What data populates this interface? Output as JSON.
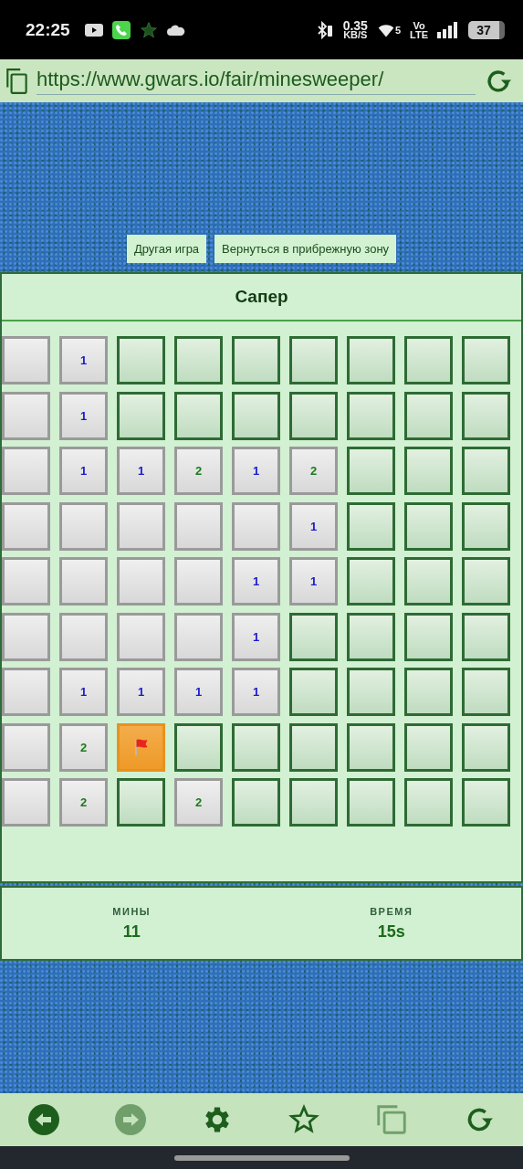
{
  "status_bar": {
    "time": "22:25",
    "speed": "0.35",
    "speed_unit": "KB/S",
    "wifi_band": "5",
    "volte_top": "Vo",
    "volte_bottom": "LTE",
    "battery": "37"
  },
  "address_bar": {
    "url": "https://www.gwars.io/fair/minesweeper/"
  },
  "top_buttons": [
    "Другая игра",
    "Вернуться в прибрежную зону"
  ],
  "game": {
    "title": "Сапер",
    "rows": [
      [
        {
          "kind": "open"
        },
        {
          "kind": "open",
          "text": "1",
          "color": "#1a1acc"
        },
        {
          "kind": "hidden"
        },
        {
          "kind": "hidden"
        },
        {
          "kind": "hidden"
        },
        {
          "kind": "hidden"
        },
        {
          "kind": "hidden"
        },
        {
          "kind": "hidden"
        },
        {
          "kind": "hidden"
        }
      ],
      [
        {
          "kind": "open"
        },
        {
          "kind": "open",
          "text": "1",
          "color": "#1a1acc"
        },
        {
          "kind": "hidden"
        },
        {
          "kind": "hidden"
        },
        {
          "kind": "hidden"
        },
        {
          "kind": "hidden"
        },
        {
          "kind": "hidden"
        },
        {
          "kind": "hidden"
        },
        {
          "kind": "hidden"
        }
      ],
      [
        {
          "kind": "open"
        },
        {
          "kind": "open",
          "text": "1",
          "color": "#1a1acc"
        },
        {
          "kind": "open",
          "text": "1",
          "color": "#1a1acc"
        },
        {
          "kind": "open",
          "text": "2",
          "color": "#1b7a1b"
        },
        {
          "kind": "open",
          "text": "1",
          "color": "#1a1acc"
        },
        {
          "kind": "open",
          "text": "2",
          "color": "#1b7a1b"
        },
        {
          "kind": "hidden"
        },
        {
          "kind": "hidden"
        },
        {
          "kind": "hidden"
        }
      ],
      [
        {
          "kind": "open"
        },
        {
          "kind": "open"
        },
        {
          "kind": "open"
        },
        {
          "kind": "open"
        },
        {
          "kind": "open"
        },
        {
          "kind": "open",
          "text": "1",
          "color": "#1a1acc"
        },
        {
          "kind": "hidden"
        },
        {
          "kind": "hidden"
        },
        {
          "kind": "hidden"
        }
      ],
      [
        {
          "kind": "open"
        },
        {
          "kind": "open"
        },
        {
          "kind": "open"
        },
        {
          "kind": "open"
        },
        {
          "kind": "open",
          "text": "1",
          "color": "#1a1acc"
        },
        {
          "kind": "open",
          "text": "1",
          "color": "#1a1acc"
        },
        {
          "kind": "hidden"
        },
        {
          "kind": "hidden"
        },
        {
          "kind": "hidden"
        }
      ],
      [
        {
          "kind": "open"
        },
        {
          "kind": "open"
        },
        {
          "kind": "open"
        },
        {
          "kind": "open"
        },
        {
          "kind": "open",
          "text": "1",
          "color": "#1a1acc"
        },
        {
          "kind": "hidden"
        },
        {
          "kind": "hidden"
        },
        {
          "kind": "hidden"
        },
        {
          "kind": "hidden"
        }
      ],
      [
        {
          "kind": "open"
        },
        {
          "kind": "open",
          "text": "1",
          "color": "#1a1acc"
        },
        {
          "kind": "open",
          "text": "1",
          "color": "#1a1acc"
        },
        {
          "kind": "open",
          "text": "1",
          "color": "#1a1acc"
        },
        {
          "kind": "open",
          "text": "1",
          "color": "#1a1acc"
        },
        {
          "kind": "hidden"
        },
        {
          "kind": "hidden"
        },
        {
          "kind": "hidden"
        },
        {
          "kind": "hidden"
        }
      ],
      [
        {
          "kind": "open"
        },
        {
          "kind": "open",
          "text": "2",
          "color": "#1b7a1b"
        },
        {
          "kind": "flag"
        },
        {
          "kind": "hidden"
        },
        {
          "kind": "hidden"
        },
        {
          "kind": "hidden"
        },
        {
          "kind": "hidden"
        },
        {
          "kind": "hidden"
        },
        {
          "kind": "hidden"
        }
      ],
      [
        {
          "kind": "open"
        },
        {
          "kind": "open",
          "text": "2",
          "color": "#1b7a1b"
        },
        {
          "kind": "hidden"
        },
        {
          "kind": "open",
          "text": "2",
          "color": "#1b7a1b"
        },
        {
          "kind": "hidden"
        },
        {
          "kind": "hidden"
        },
        {
          "kind": "hidden"
        },
        {
          "kind": "hidden"
        },
        {
          "kind": "hidden"
        }
      ]
    ]
  },
  "stats": [
    {
      "label": "МИНЫ",
      "value": "11"
    },
    {
      "label": "ВРЕМЯ",
      "value": "15s"
    }
  ],
  "bottom_nav": [
    {
      "kind": "back",
      "disabled": false
    },
    {
      "kind": "forward",
      "disabled": true
    },
    {
      "kind": "settings",
      "disabled": false
    },
    {
      "kind": "bookmark",
      "disabled": false
    },
    {
      "kind": "tabs",
      "disabled": true
    },
    {
      "kind": "reload",
      "disabled": false
    }
  ]
}
